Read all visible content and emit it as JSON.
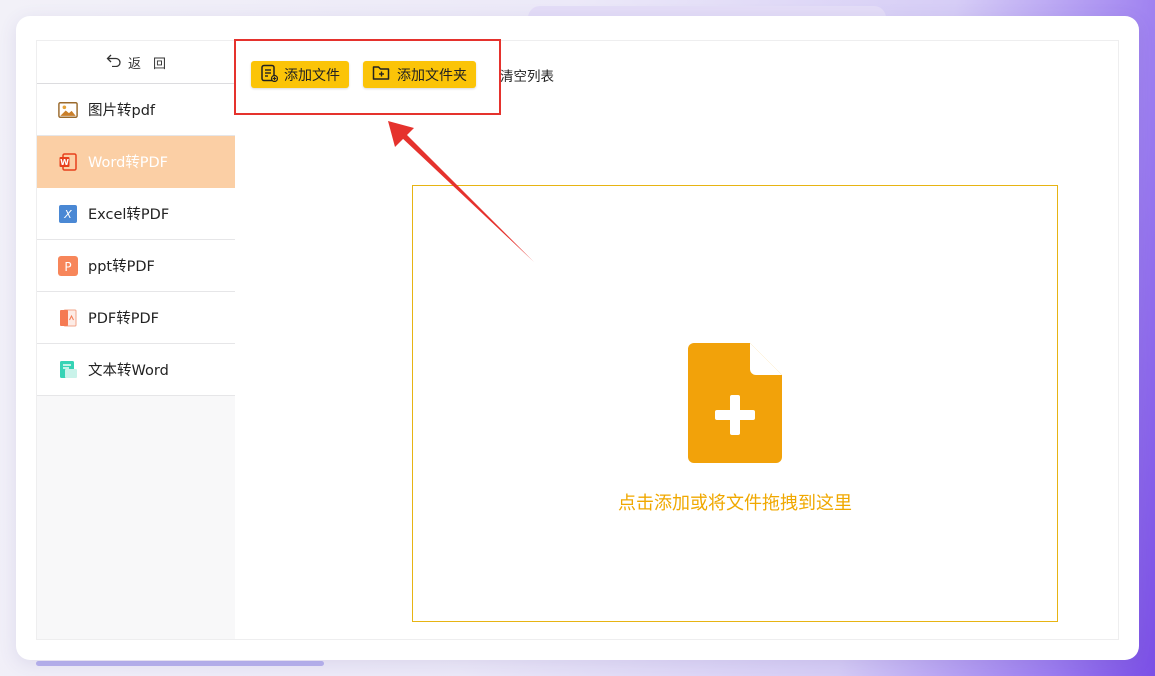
{
  "sidebar": {
    "back_label": "返回",
    "items": [
      {
        "label": "图片转pdf",
        "icon": "image-icon",
        "active": false
      },
      {
        "label": "Word转PDF",
        "icon": "word-icon",
        "active": true
      },
      {
        "label": "Excel转PDF",
        "icon": "excel-icon",
        "active": false
      },
      {
        "label": "ppt转PDF",
        "icon": "ppt-icon",
        "active": false
      },
      {
        "label": "PDF转PDF",
        "icon": "pdf-icon",
        "active": false
      },
      {
        "label": "文本转Word",
        "icon": "text-doc-icon",
        "active": false
      }
    ]
  },
  "toolbar": {
    "add_file_label": "添加文件",
    "add_folder_label": "添加文件夹",
    "clear_label": "清空列表"
  },
  "dropzone": {
    "hint": "点击添加或将文件拖拽到这里"
  },
  "colors": {
    "accent_yellow": "#fbc408",
    "active_sidebar": "#fbcfa5",
    "drop_icon": "#f2a20a",
    "highlight_red": "#e5322d"
  }
}
